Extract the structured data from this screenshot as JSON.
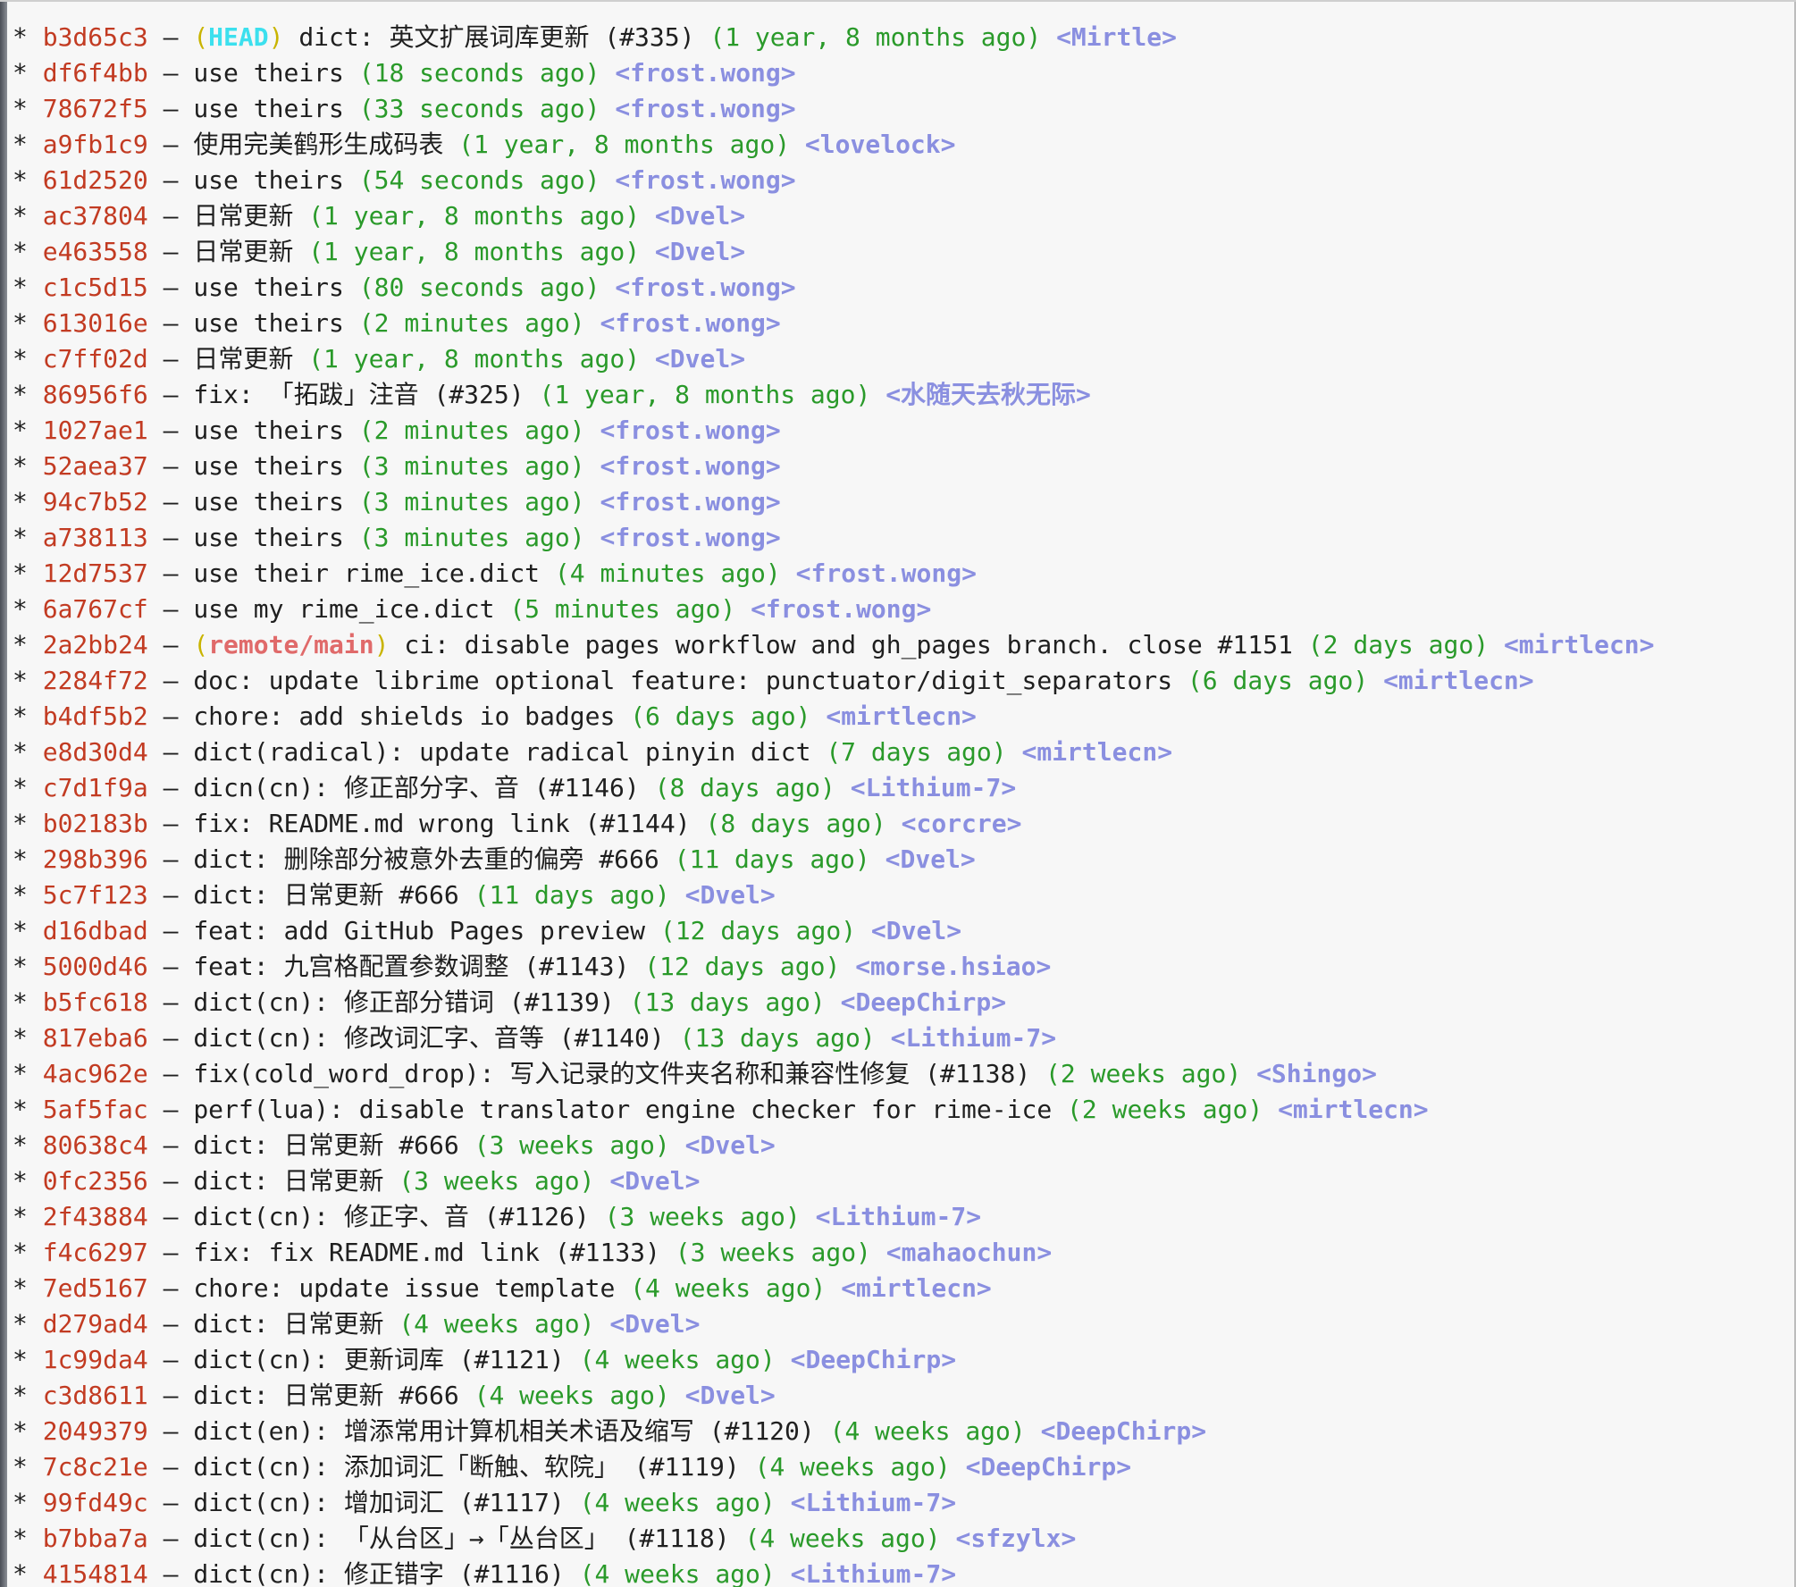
{
  "terminal": {
    "commits": [
      {
        "graph": "*",
        "hash": "b3d65c3",
        "refs": "HEAD",
        "ref_type": "head",
        "message": "dict: 英文扩展词库更新 (#335)",
        "date": "(1 year, 8 months ago)",
        "author": "<Mirtle>"
      },
      {
        "graph": "*",
        "hash": "df6f4bb",
        "message": "use theirs",
        "date": "(18 seconds ago)",
        "author": "<frost.wong>"
      },
      {
        "graph": "*",
        "hash": "78672f5",
        "message": "use theirs",
        "date": "(33 seconds ago)",
        "author": "<frost.wong>"
      },
      {
        "graph": "*",
        "hash": "a9fb1c9",
        "message": "使用完美鹤形生成码表",
        "date": "(1 year, 8 months ago)",
        "author": "<lovelock>"
      },
      {
        "graph": "*",
        "hash": "61d2520",
        "message": "use theirs",
        "date": "(54 seconds ago)",
        "author": "<frost.wong>"
      },
      {
        "graph": "*",
        "hash": "ac37804",
        "message": "日常更新",
        "date": "(1 year, 8 months ago)",
        "author": "<Dvel>"
      },
      {
        "graph": "*",
        "hash": "e463558",
        "message": "日常更新",
        "date": "(1 year, 8 months ago)",
        "author": "<Dvel>"
      },
      {
        "graph": "*",
        "hash": "c1c5d15",
        "message": "use theirs",
        "date": "(80 seconds ago)",
        "author": "<frost.wong>"
      },
      {
        "graph": "*",
        "hash": "613016e",
        "message": "use theirs",
        "date": "(2 minutes ago)",
        "author": "<frost.wong>"
      },
      {
        "graph": "*",
        "hash": "c7ff02d",
        "message": "日常更新",
        "date": "(1 year, 8 months ago)",
        "author": "<Dvel>"
      },
      {
        "graph": "*",
        "hash": "86956f6",
        "message": "fix: 「拓跋」注音 (#325)",
        "date": "(1 year, 8 months ago)",
        "author": "<水随天去秋无际>"
      },
      {
        "graph": "*",
        "hash": "1027ae1",
        "message": "use theirs",
        "date": "(2 minutes ago)",
        "author": "<frost.wong>"
      },
      {
        "graph": "*",
        "hash": "52aea37",
        "message": "use theirs",
        "date": "(3 minutes ago)",
        "author": "<frost.wong>"
      },
      {
        "graph": "*",
        "hash": "94c7b52",
        "message": "use theirs",
        "date": "(3 minutes ago)",
        "author": "<frost.wong>"
      },
      {
        "graph": "*",
        "hash": "a738113",
        "message": "use theirs",
        "date": "(3 minutes ago)",
        "author": "<frost.wong>"
      },
      {
        "graph": "*",
        "hash": "12d7537",
        "message": "use their rime_ice.dict",
        "date": "(4 minutes ago)",
        "author": "<frost.wong>"
      },
      {
        "graph": "*",
        "hash": "6a767cf",
        "message": "use my rime_ice.dict",
        "date": "(5 minutes ago)",
        "author": "<frost.wong>"
      },
      {
        "graph": "*",
        "hash": "2a2bb24",
        "refs": "remote/main",
        "ref_type": "remote",
        "message": "ci: disable pages workflow and gh_pages branch. close #1151",
        "date": "(2 days ago)",
        "author": "<mirtlecn>"
      },
      {
        "graph": "*",
        "hash": "2284f72",
        "message": "doc: update librime optional feature: punctuator/digit_separators",
        "date": "(6 days ago)",
        "author": "<mirtlecn>"
      },
      {
        "graph": "*",
        "hash": "b4df5b2",
        "message": "chore: add shields io badges",
        "date": "(6 days ago)",
        "author": "<mirtlecn>"
      },
      {
        "graph": "*",
        "hash": "e8d30d4",
        "message": "dict(radical): update radical pinyin dict",
        "date": "(7 days ago)",
        "author": "<mirtlecn>"
      },
      {
        "graph": "*",
        "hash": "c7d1f9a",
        "message": "dicn(cn): 修正部分字、音 (#1146)",
        "date": "(8 days ago)",
        "author": "<Lithium-7>"
      },
      {
        "graph": "*",
        "hash": "b02183b",
        "message": "fix: README.md wrong link (#1144)",
        "date": "(8 days ago)",
        "author": "<corcre>"
      },
      {
        "graph": "*",
        "hash": "298b396",
        "message": "dict: 删除部分被意外去重的偏旁 #666",
        "date": "(11 days ago)",
        "author": "<Dvel>"
      },
      {
        "graph": "*",
        "hash": "5c7f123",
        "message": "dict: 日常更新 #666",
        "date": "(11 days ago)",
        "author": "<Dvel>"
      },
      {
        "graph": "*",
        "hash": "d16dbad",
        "message": "feat: add GitHub Pages preview",
        "date": "(12 days ago)",
        "author": "<Dvel>"
      },
      {
        "graph": "*",
        "hash": "5000d46",
        "message": "feat: 九宫格配置参数调整 (#1143)",
        "date": "(12 days ago)",
        "author": "<morse.hsiao>"
      },
      {
        "graph": "*",
        "hash": "b5fc618",
        "message": "dict(cn): 修正部分错词 (#1139)",
        "date": "(13 days ago)",
        "author": "<DeepChirp>"
      },
      {
        "graph": "*",
        "hash": "817eba6",
        "message": "dict(cn): 修改词汇字、音等 (#1140)",
        "date": "(13 days ago)",
        "author": "<Lithium-7>"
      },
      {
        "graph": "*",
        "hash": "4ac962e",
        "message": "fix(cold_word_drop): 写入记录的文件夹名称和兼容性修复 (#1138)",
        "date": "(2 weeks ago)",
        "author": "<Shingo>"
      },
      {
        "graph": "*",
        "hash": "5af5fac",
        "message": "perf(lua): disable translator engine checker for rime-ice",
        "date": "(2 weeks ago)",
        "author": "<mirtlecn>"
      },
      {
        "graph": "*",
        "hash": "80638c4",
        "message": "dict: 日常更新 #666",
        "date": "(3 weeks ago)",
        "author": "<Dvel>"
      },
      {
        "graph": "*",
        "hash": "0fc2356",
        "message": "dict: 日常更新",
        "date": "(3 weeks ago)",
        "author": "<Dvel>"
      },
      {
        "graph": "*",
        "hash": "2f43884",
        "message": "dict(cn): 修正字、音 (#1126)",
        "date": "(3 weeks ago)",
        "author": "<Lithium-7>"
      },
      {
        "graph": "*",
        "hash": "f4c6297",
        "message": "fix: fix README.md link (#1133)",
        "date": "(3 weeks ago)",
        "author": "<mahaochun>"
      },
      {
        "graph": "*",
        "hash": "7ed5167",
        "message": "chore: update issue template",
        "date": "(4 weeks ago)",
        "author": "<mirtlecn>"
      },
      {
        "graph": "*",
        "hash": "d279ad4",
        "message": "dict: 日常更新",
        "date": "(4 weeks ago)",
        "author": "<Dvel>"
      },
      {
        "graph": "*",
        "hash": "1c99da4",
        "message": "dict(cn): 更新词库 (#1121)",
        "date": "(4 weeks ago)",
        "author": "<DeepChirp>"
      },
      {
        "graph": "*",
        "hash": "c3d8611",
        "message": "dict: 日常更新 #666",
        "date": "(4 weeks ago)",
        "author": "<Dvel>"
      },
      {
        "graph": "*",
        "hash": "2049379",
        "message": "dict(en): 增添常用计算机相关术语及缩写 (#1120)",
        "date": "(4 weeks ago)",
        "author": "<DeepChirp>"
      },
      {
        "graph": "*",
        "hash": "7c8c21e",
        "message": "dict(cn): 添加词汇「断触、软院」 (#1119)",
        "date": "(4 weeks ago)",
        "author": "<DeepChirp>"
      },
      {
        "graph": "*",
        "hash": "99fd49c",
        "message": "dict(cn): 增加词汇 (#1117)",
        "date": "(4 weeks ago)",
        "author": "<Lithium-7>"
      },
      {
        "graph": "*",
        "hash": "b7bba7a",
        "message": "dict(cn): 「从台区」→「丛台区」 (#1118)",
        "date": "(4 weeks ago)",
        "author": "<sfzylx>"
      },
      {
        "graph": "*",
        "hash": "4154814",
        "message": "dict(cn): 修正错字 (#1116)",
        "date": "(4 weeks ago)",
        "author": "<Lithium-7>"
      }
    ]
  },
  "colors": {
    "background": "#f7f7f7",
    "hash": "#c23b22",
    "date": "#2a9a2a",
    "author": "#8a8fe0",
    "ref_paren": "#c9b400",
    "ref_head": "#3ce0ee",
    "ref_remote": "#e06a6a"
  }
}
